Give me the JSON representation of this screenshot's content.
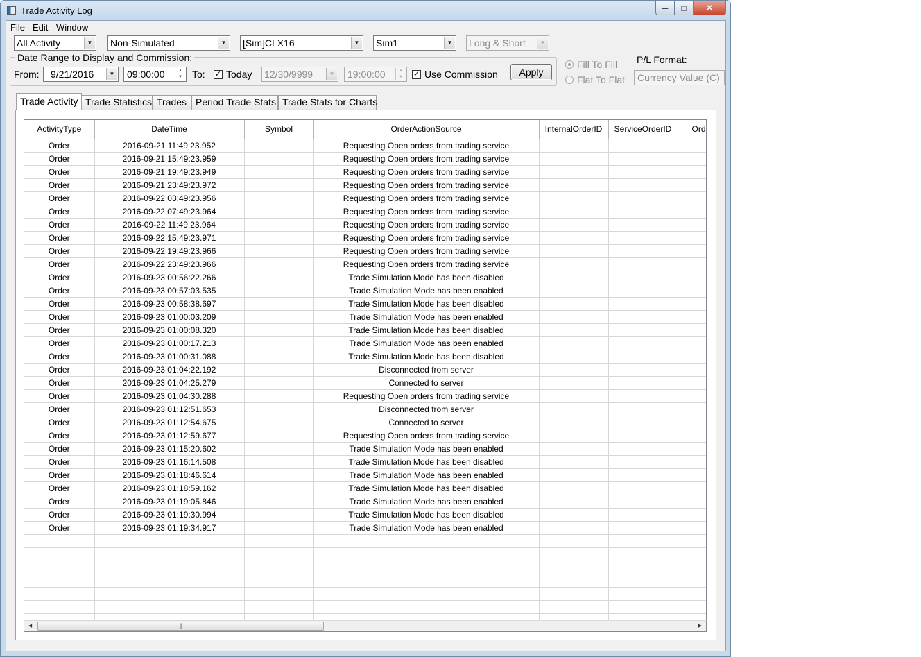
{
  "window": {
    "title": "Trade Activity Log"
  },
  "menu": [
    "File",
    "Edit",
    "Window"
  ],
  "filters": {
    "activity": "All Activity",
    "simulation": "Non-Simulated",
    "symbol": "[Sim]CLX16",
    "account": "Sim1",
    "side": "Long & Short"
  },
  "date_range": {
    "legend": "Date Range to Display and Commission:",
    "from_label": "From:",
    "from_date": "9/21/2016",
    "from_time": "09:00:00",
    "to_label": "To:",
    "today_checked": true,
    "today_label": "Today",
    "to_date": "12/30/9999",
    "to_time": "19:00:00",
    "use_commission_checked": true,
    "use_commission_label": "Use Commission",
    "apply_label": "Apply"
  },
  "fill_options": {
    "fill_to_fill": "Fill To Fill",
    "flat_to_flat": "Flat To Flat",
    "selected": "fill_to_fill"
  },
  "pl_format": {
    "label": "P/L Format:",
    "value": "Currency Value (C)"
  },
  "tabs": [
    {
      "label": "Trade Activity",
      "active": true
    },
    {
      "label": "Trade Statistics",
      "active": false
    },
    {
      "label": "Trades",
      "active": false
    },
    {
      "label": "Period Trade Stats",
      "active": false
    },
    {
      "label": "Trade Stats for Charts",
      "active": false
    }
  ],
  "table": {
    "columns": [
      "ActivityType",
      "DateTime",
      "Symbol",
      "OrderActionSource",
      "InternalOrderID",
      "ServiceOrderID",
      "OrderType"
    ],
    "rows": [
      [
        "Order",
        "2016-09-21 11:49:23.952",
        "",
        "Requesting Open orders from trading service",
        "",
        "",
        ""
      ],
      [
        "Order",
        "2016-09-21 15:49:23.959",
        "",
        "Requesting Open orders from trading service",
        "",
        "",
        ""
      ],
      [
        "Order",
        "2016-09-21 19:49:23.949",
        "",
        "Requesting Open orders from trading service",
        "",
        "",
        ""
      ],
      [
        "Order",
        "2016-09-21 23:49:23.972",
        "",
        "Requesting Open orders from trading service",
        "",
        "",
        ""
      ],
      [
        "Order",
        "2016-09-22 03:49:23.956",
        "",
        "Requesting Open orders from trading service",
        "",
        "",
        ""
      ],
      [
        "Order",
        "2016-09-22 07:49:23.964",
        "",
        "Requesting Open orders from trading service",
        "",
        "",
        ""
      ],
      [
        "Order",
        "2016-09-22 11:49:23.964",
        "",
        "Requesting Open orders from trading service",
        "",
        "",
        ""
      ],
      [
        "Order",
        "2016-09-22 15:49:23.971",
        "",
        "Requesting Open orders from trading service",
        "",
        "",
        ""
      ],
      [
        "Order",
        "2016-09-22 19:49:23.966",
        "",
        "Requesting Open orders from trading service",
        "",
        "",
        ""
      ],
      [
        "Order",
        "2016-09-22 23:49:23.966",
        "",
        "Requesting Open orders from trading service",
        "",
        "",
        ""
      ],
      [
        "Order",
        "2016-09-23 00:56:22.266",
        "",
        "Trade Simulation Mode has been disabled",
        "",
        "",
        ""
      ],
      [
        "Order",
        "2016-09-23 00:57:03.535",
        "",
        "Trade Simulation Mode has been enabled",
        "",
        "",
        ""
      ],
      [
        "Order",
        "2016-09-23 00:58:38.697",
        "",
        "Trade Simulation Mode has been disabled",
        "",
        "",
        ""
      ],
      [
        "Order",
        "2016-09-23 01:00:03.209",
        "",
        "Trade Simulation Mode has been enabled",
        "",
        "",
        ""
      ],
      [
        "Order",
        "2016-09-23 01:00:08.320",
        "",
        "Trade Simulation Mode has been disabled",
        "",
        "",
        ""
      ],
      [
        "Order",
        "2016-09-23 01:00:17.213",
        "",
        "Trade Simulation Mode has been enabled",
        "",
        "",
        ""
      ],
      [
        "Order",
        "2016-09-23 01:00:31.088",
        "",
        "Trade Simulation Mode has been disabled",
        "",
        "",
        ""
      ],
      [
        "Order",
        "2016-09-23 01:04:22.192",
        "",
        "Disconnected from server",
        "",
        "",
        ""
      ],
      [
        "Order",
        "2016-09-23 01:04:25.279",
        "",
        "Connected to server",
        "",
        "",
        ""
      ],
      [
        "Order",
        "2016-09-23 01:04:30.288",
        "",
        "Requesting Open orders from trading service",
        "",
        "",
        ""
      ],
      [
        "Order",
        "2016-09-23 01:12:51.653",
        "",
        "Disconnected from server",
        "",
        "",
        ""
      ],
      [
        "Order",
        "2016-09-23 01:12:54.675",
        "",
        "Connected to server",
        "",
        "",
        ""
      ],
      [
        "Order",
        "2016-09-23 01:12:59.677",
        "",
        "Requesting Open orders from trading service",
        "",
        "",
        ""
      ],
      [
        "Order",
        "2016-09-23 01:15:20.602",
        "",
        "Trade Simulation Mode has been enabled",
        "",
        "",
        ""
      ],
      [
        "Order",
        "2016-09-23 01:16:14.508",
        "",
        "Trade Simulation Mode has been disabled",
        "",
        "",
        ""
      ],
      [
        "Order",
        "2016-09-23 01:18:46.614",
        "",
        "Trade Simulation Mode has been enabled",
        "",
        "",
        ""
      ],
      [
        "Order",
        "2016-09-23 01:18:59.162",
        "",
        "Trade Simulation Mode has been disabled",
        "",
        "",
        ""
      ],
      [
        "Order",
        "2016-09-23 01:19:05.846",
        "",
        "Trade Simulation Mode has been enabled",
        "",
        "",
        ""
      ],
      [
        "Order",
        "2016-09-23 01:19:30.994",
        "",
        "Trade Simulation Mode has been disabled",
        "",
        "",
        ""
      ],
      [
        "Order",
        "2016-09-23 01:19:34.917",
        "",
        "Trade Simulation Mode has been enabled",
        "",
        "",
        ""
      ]
    ],
    "empty_rows": 7
  }
}
